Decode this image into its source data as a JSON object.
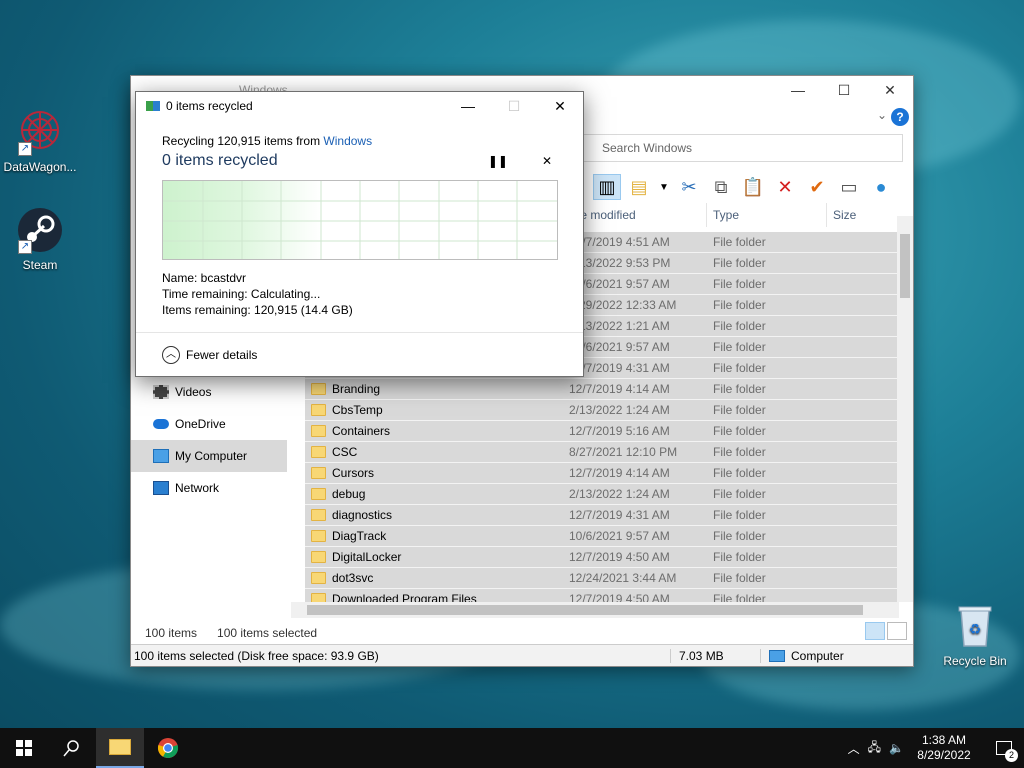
{
  "desktop": {
    "icons": [
      {
        "label": "DataWagon..."
      },
      {
        "label": "Steam"
      },
      {
        "label": "Recycle Bin"
      }
    ]
  },
  "explorer": {
    "title": "Windows",
    "search_placeholder": "Search Windows",
    "columns": [
      "te modified",
      "Type",
      "Size"
    ],
    "sidebar": [
      {
        "label": "Videos"
      },
      {
        "label": "OneDrive"
      },
      {
        "label": "My Computer"
      },
      {
        "label": "Network"
      }
    ],
    "rows": [
      {
        "name": "",
        "date": "12/7/2019 4:51 AM",
        "type": "File folder"
      },
      {
        "name": "",
        "date": "2/13/2022 9:53 PM",
        "type": "File folder"
      },
      {
        "name": "",
        "date": "10/6/2021 9:57 AM",
        "type": "File folder"
      },
      {
        "name": "",
        "date": "8/29/2022 12:33 AM",
        "type": "File folder"
      },
      {
        "name": "",
        "date": "2/13/2022 1:21 AM",
        "type": "File folder"
      },
      {
        "name": "",
        "date": "10/6/2021 9:57 AM",
        "type": "File folder"
      },
      {
        "name": "",
        "date": "12/7/2019 4:31 AM",
        "type": "File folder"
      },
      {
        "name": "Branding",
        "date": "12/7/2019 4:14 AM",
        "type": "File folder"
      },
      {
        "name": "CbsTemp",
        "date": "2/13/2022 1:24 AM",
        "type": "File folder"
      },
      {
        "name": "Containers",
        "date": "12/7/2019 5:16 AM",
        "type": "File folder"
      },
      {
        "name": "CSC",
        "date": "8/27/2021 12:10 PM",
        "type": "File folder"
      },
      {
        "name": "Cursors",
        "date": "12/7/2019 4:14 AM",
        "type": "File folder"
      },
      {
        "name": "debug",
        "date": "2/13/2022 1:24 AM",
        "type": "File folder"
      },
      {
        "name": "diagnostics",
        "date": "12/7/2019 4:31 AM",
        "type": "File folder"
      },
      {
        "name": "DiagTrack",
        "date": "10/6/2021 9:57 AM",
        "type": "File folder"
      },
      {
        "name": "DigitalLocker",
        "date": "12/7/2019 4:50 AM",
        "type": "File folder"
      },
      {
        "name": "dot3svc",
        "date": "12/24/2021 3:44 AM",
        "type": "File folder"
      },
      {
        "name": "Downloaded Program Files",
        "date": "12/7/2019 4:50 AM",
        "type": "File folder"
      }
    ],
    "item_count": "100 items",
    "selected_count": "100 items selected",
    "status": {
      "selection": "100 items selected (Disk free space: 93.9 GB)",
      "size": "7.03 MB",
      "location": "Computer"
    }
  },
  "dialog": {
    "title": "0 items recycled",
    "line_prefix": "Recycling 120,915 items from",
    "line_link": "Windows",
    "heading": "0 items recycled",
    "pause_icon": "pause-icon",
    "cancel_icon": "close-icon",
    "name_line": "Name:  bcastdvr",
    "time_line": "Time remaining:  Calculating...",
    "items_line": "Items remaining:  120,915 (14.4 GB)",
    "fewer_details": "Fewer details"
  },
  "taskbar": {
    "time": "1:38 AM",
    "date": "8/29/2022",
    "notification_count": "2"
  }
}
